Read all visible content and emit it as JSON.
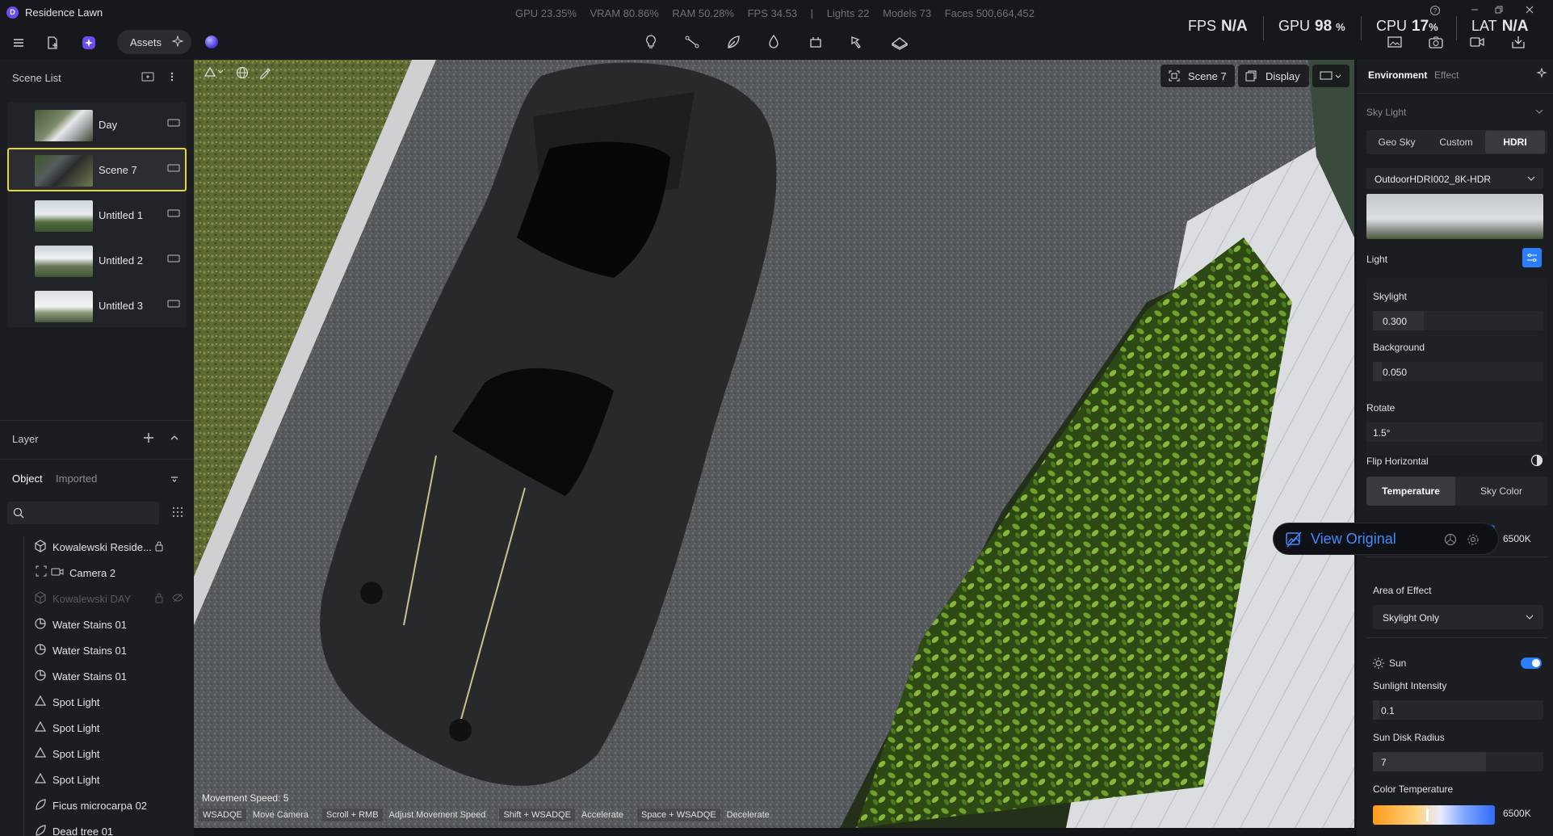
{
  "app": {
    "logo_letter": "D",
    "title": "Residence Lawn"
  },
  "stats": {
    "gpu": "GPU 23.35%",
    "vram": "VRAM 80.86%",
    "ram": "RAM 50.28%",
    "fps": "FPS 34.53",
    "separator": "|",
    "lights": "Lights 22",
    "models": "Models 73",
    "faces": "Faces 500,664,452"
  },
  "perf_overlay": {
    "fps_label": "FPS",
    "fps_value": "N/A",
    "gpu_label": "GPU",
    "gpu_value": "98",
    "gpu_unit": "%",
    "cpu_label": "CPU",
    "cpu_value": "17",
    "cpu_unit": "%",
    "lat_label": "LAT",
    "lat_value": "N/A"
  },
  "toolbar": {
    "assets_label": "Assets"
  },
  "scene_list": {
    "title": "Scene List",
    "items": [
      {
        "label": "Day"
      },
      {
        "label": "Scene 7"
      },
      {
        "label": "Untitled 1"
      },
      {
        "label": "Untitled 2"
      },
      {
        "label": "Untitled 3"
      }
    ],
    "selected": "Scene 7"
  },
  "layer": {
    "title": "Layer",
    "tabs": [
      "Object",
      "Imported"
    ],
    "active_tab": "Object",
    "search_placeholder": "",
    "items": [
      {
        "label": "Kowalewski Reside...",
        "icon": "cube-icon"
      },
      {
        "label": "Camera 2",
        "icon": "camera-icon"
      },
      {
        "label": "Kowalewski DAY",
        "icon": "cube-icon"
      },
      {
        "label": "Water Stains 01",
        "icon": "decal-icon"
      },
      {
        "label": "Water Stains 01",
        "icon": "decal-icon"
      },
      {
        "label": "Water Stains 01",
        "icon": "decal-icon"
      },
      {
        "label": "Spot Light",
        "icon": "spotlight-icon"
      },
      {
        "label": "Spot Light",
        "icon": "spotlight-icon"
      },
      {
        "label": "Spot Light",
        "icon": "spotlight-icon"
      },
      {
        "label": "Spot Light",
        "icon": "spotlight-icon"
      },
      {
        "label": "Ficus microcarpa 02",
        "icon": "leaf-icon"
      },
      {
        "label": "Dead tree 01",
        "icon": "leaf-icon"
      }
    ]
  },
  "viewport": {
    "scene_chip": "Scene 7",
    "display_chip": "Display",
    "movement_speed": "Movement Speed: 5",
    "hints": [
      {
        "key": "WSADQE",
        "label": "Move Camera"
      },
      {
        "key": "Scroll + RMB",
        "label": "Adjust Movement Speed"
      },
      {
        "key": "Shift + WSADQE",
        "label": "Accelerate"
      },
      {
        "key": "Space + WSADQE",
        "label": "Decelerate"
      }
    ]
  },
  "view_original": {
    "label": "View Original"
  },
  "right_panel": {
    "tabs": [
      "Environment",
      "Effect"
    ],
    "active_tab": "Environment",
    "sky_light_title": "Sky Light",
    "sky_modes": [
      "Geo Sky",
      "Custom",
      "HDRI"
    ],
    "active_sky_mode": "HDRI",
    "hdri_name": "OutdoorHDRI002_8K-HDR",
    "light_title": "Light",
    "skylight_label": "Skylight",
    "skylight_value": "0.300",
    "background_label": "Background",
    "background_value": "0.050",
    "rotate_label": "Rotate",
    "rotate_value": "1.5°",
    "flip_label": "Flip Horizontal",
    "temp_tabs": [
      "Temperature",
      "Sky Color"
    ],
    "active_temp_tab": "Temperature",
    "sky_temperature_value": "6500K",
    "area_label": "Area of Effect",
    "area_value": "Skylight Only",
    "sun_label": "Sun",
    "sun_enabled": true,
    "sun_intensity_label": "Sunlight Intensity",
    "sun_intensity_value": "0.1",
    "sun_disk_label": "Sun Disk Radius",
    "sun_disk_value": "7",
    "color_temp_label": "Color Temperature",
    "color_temp_value": "6500K",
    "accent": "#2a7fff"
  }
}
